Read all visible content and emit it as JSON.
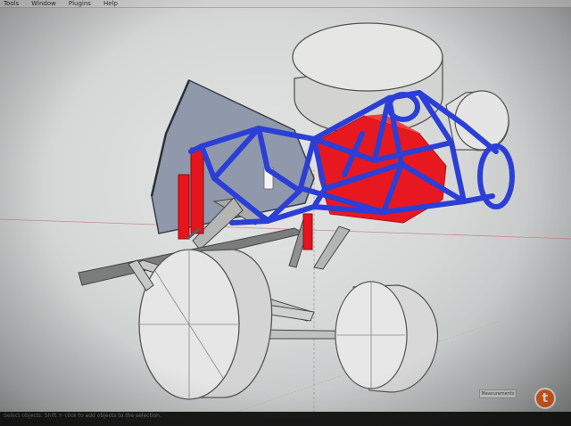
{
  "menu": {
    "items": [
      "Tools",
      "Window",
      "Plugins",
      "Help"
    ]
  },
  "status": {
    "hint": "Select objects. Shift + click to add objects to the selection.",
    "measurements": "Measurements"
  },
  "watermark": {
    "glyph": "t"
  },
  "model": {
    "frame_color": "#2b3fd6",
    "shock_color": "#e8141c",
    "box_color": "#e81820",
    "panel_color": "#8c96a8",
    "wheel_color": "#e2e4e3",
    "axle_color": "#7b7d7d"
  }
}
